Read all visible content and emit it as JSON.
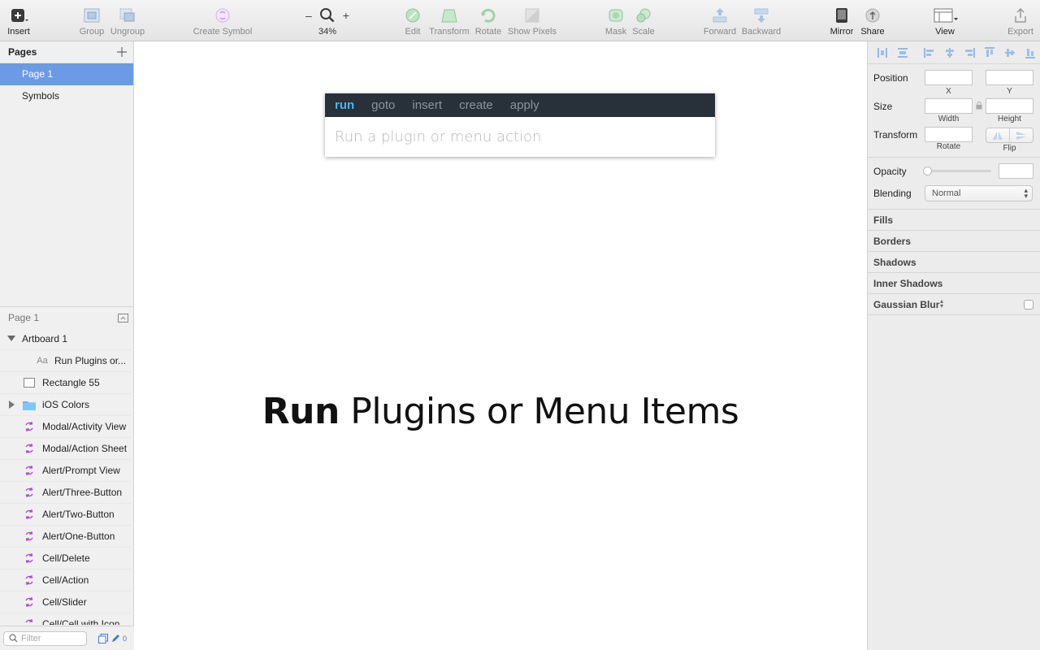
{
  "toolbar": {
    "insert": "Insert",
    "group": "Group",
    "ungroup": "Ungroup",
    "create_symbol": "Create Symbol",
    "zoom": "34%",
    "zoom_minus": "–",
    "zoom_plus": "+",
    "edit": "Edit",
    "transform": "Transform",
    "rotate": "Rotate",
    "show_pixels": "Show Pixels",
    "mask": "Mask",
    "scale": "Scale",
    "forward": "Forward",
    "backward": "Backward",
    "mirror": "Mirror",
    "share": "Share",
    "view": "View",
    "export": "Export"
  },
  "pages": {
    "title": "Pages",
    "items": [
      "Page 1",
      "Symbols"
    ],
    "selected": "Page 1"
  },
  "layers": {
    "title": "Page 1",
    "items": [
      {
        "label": "Artboard 1",
        "icon": "disclosure-open-icon"
      },
      {
        "label": "Run Plugins or...",
        "icon": "text-layer-icon"
      },
      {
        "label": "Rectangle 55",
        "icon": "rectangle-icon"
      },
      {
        "label": "iOS Colors",
        "icon": "folder-icon"
      },
      {
        "label": "Modal/Activity View",
        "icon": "symbol-icon"
      },
      {
        "label": "Modal/Action Sheet",
        "icon": "symbol-icon"
      },
      {
        "label": "Alert/Prompt View",
        "icon": "symbol-icon"
      },
      {
        "label": "Alert/Three-Button",
        "icon": "symbol-icon"
      },
      {
        "label": "Alert/Two-Button",
        "icon": "symbol-icon"
      },
      {
        "label": "Alert/One-Button",
        "icon": "symbol-icon"
      },
      {
        "label": "Cell/Delete",
        "icon": "symbol-icon"
      },
      {
        "label": "Cell/Action",
        "icon": "symbol-icon"
      },
      {
        "label": "Cell/Slider",
        "icon": "symbol-icon"
      },
      {
        "label": "Cell/Cell with Icon",
        "icon": "symbol-icon"
      }
    ],
    "text_icon_glyph": "Aa"
  },
  "filter": {
    "placeholder": "Filter",
    "count": "0"
  },
  "runner": {
    "tabs": [
      "run",
      "goto",
      "insert",
      "create",
      "apply"
    ],
    "active_tab": "run",
    "placeholder": "Run a plugin or menu action",
    "value": "",
    "accent": "#4cb6ee",
    "bar_color": "#283039"
  },
  "headline": {
    "bold": "Run",
    "rest": "Plugins or Menu Items"
  },
  "inspector": {
    "position": "Position",
    "x": "X",
    "y": "Y",
    "size": "Size",
    "width": "Width",
    "height": "Height",
    "transform": "Transform",
    "rotate": "Rotate",
    "flip": "Flip",
    "opacity": "Opacity",
    "blending": "Blending",
    "blending_value": "Normal",
    "sections": [
      "Fills",
      "Borders",
      "Shadows",
      "Inner Shadows",
      "Gaussian Blur"
    ]
  },
  "colors": {
    "selection": "#6b9ae6",
    "symbol_icon": "#a64ad1"
  }
}
